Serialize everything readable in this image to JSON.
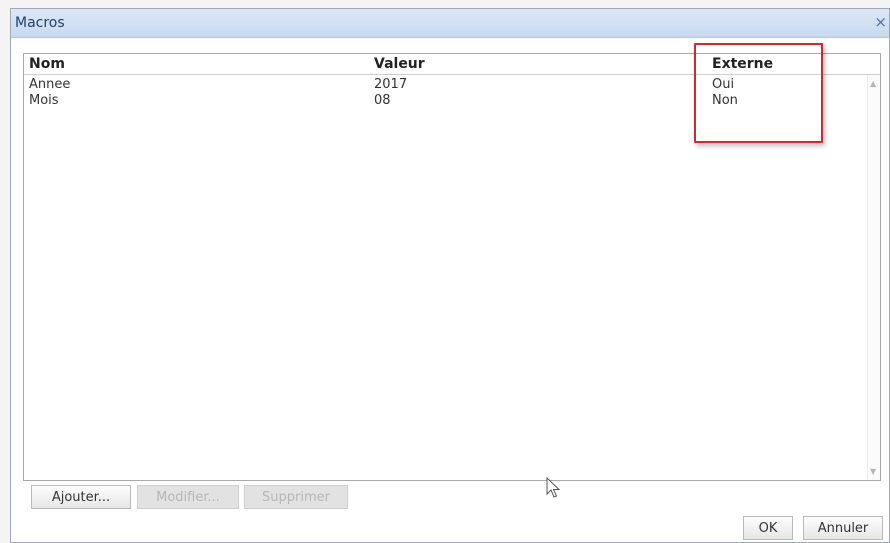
{
  "window": {
    "title": "Macros",
    "close_glyph": "×"
  },
  "table": {
    "columns": [
      "Nom",
      "Valeur",
      "Externe"
    ],
    "rows": [
      [
        "Annee",
        "2017",
        "Oui"
      ],
      [
        "Mois",
        "08",
        "Non"
      ]
    ]
  },
  "buttons": {
    "add": "Ajouter...",
    "edit": "Modifier...",
    "delete": "Supprimer",
    "ok": "OK",
    "cancel": "Annuler"
  },
  "icons": {
    "close": "close-icon",
    "scroll_up": "chevron-up-icon",
    "scroll_down": "chevron-down-icon",
    "cursor": "mouse-cursor-icon"
  },
  "colors": {
    "highlight": "#cc2b35",
    "titlebar": "#c8d9ef",
    "title_text": "#1f3f73"
  }
}
